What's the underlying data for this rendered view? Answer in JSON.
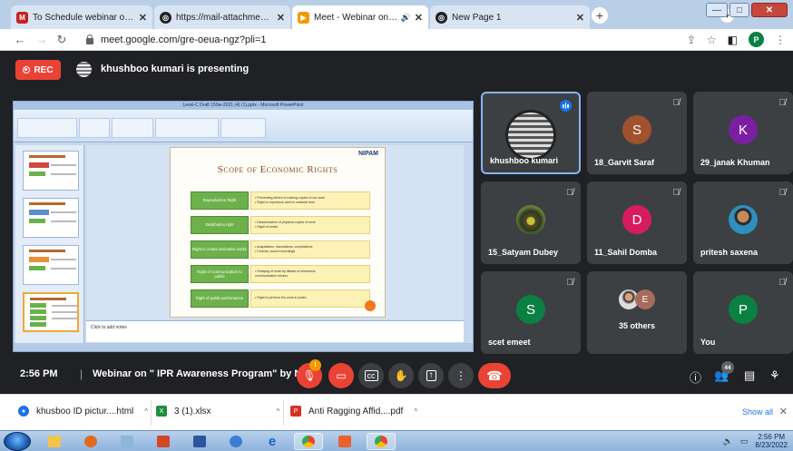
{
  "browser": {
    "tabs": [
      {
        "title": "To Schedule webinar on IPR Aw",
        "favicon_color": "#c5221f",
        "active": false
      },
      {
        "title": "https://mail-attachment.googleu",
        "favicon_color": "#202124",
        "active": false
      },
      {
        "title": "Meet - Webinar on \" IPR Aw",
        "favicon_color": "#f29900",
        "active": true
      },
      {
        "title": "New Page 1",
        "favicon_color": "#202124",
        "active": false
      }
    ],
    "url": "meet.google.com/gre-oeua-ngz?pli=1",
    "profile_initial": "P"
  },
  "meet": {
    "rec_label": "REC",
    "presenting_text": "khushboo kumari is presenting",
    "slide": {
      "window_title": "Level-C Draft 150w-2021 (4) (1).pptx - Microsoft PowerPoint",
      "logo": "NIPAM",
      "title": "Scope of Economic Rights",
      "notes_placeholder": "Click to add notes",
      "rows": [
        {
          "label": "Reproduction Right",
          "desc": [
            "• Preventing others of making copies of our work",
            "• Right to reproduce work in material form"
          ]
        },
        {
          "label": "Distribution right",
          "desc": [
            "• Dissemination of physical copies of work",
            "• Right of rental"
          ]
        },
        {
          "label": "Right to create derivative works",
          "desc": [
            "• Adaptations, translations, compilations",
            "• Cinema, sound recordings"
          ]
        },
        {
          "label": "Right of communication to public",
          "desc": [
            "• Relaying of work by distant or interactive",
            "  communication means"
          ]
        },
        {
          "label": "Right of public performance",
          "desc": [
            "• Right to perform the work in public"
          ]
        }
      ]
    },
    "participants": [
      {
        "name": "khushboo kumari",
        "initial": "",
        "color": "",
        "speaking": true
      },
      {
        "name": "18_Garvit Saraf",
        "initial": "S",
        "color": "#a0522d",
        "speaking": false
      },
      {
        "name": "29_janak Khuman",
        "initial": "K",
        "color": "#7b1fa2",
        "speaking": false
      },
      {
        "name": "15_Satyam Dubey",
        "initial": "",
        "color": "",
        "speaking": false
      },
      {
        "name": "11_Sahil Domba",
        "initial": "D",
        "color": "#d81b60",
        "speaking": false
      },
      {
        "name": "pritesh saxena",
        "initial": "",
        "color": "",
        "speaking": false
      },
      {
        "name": "scet emeet",
        "initial": "S",
        "color": "#0b8043",
        "speaking": false
      },
      {
        "name": "35 others",
        "initial": "E",
        "color": "#a66b5b",
        "speaking": false
      },
      {
        "name": "You",
        "initial": "P",
        "color": "#0b8043",
        "speaking": false
      }
    ],
    "bottom": {
      "time": "2:56 PM",
      "separator": "|",
      "meeting_title": "Webinar on \" IPR Awareness Program\" by N...",
      "mic_badge": "!",
      "people_count": "44"
    }
  },
  "downloads": {
    "items": [
      {
        "name": "khusboo ID pictur....html",
        "icon_color": "#1a73e8"
      },
      {
        "name": "3 (1).xlsx",
        "icon_color": "#1e8e3e"
      },
      {
        "name": "Anti Ragging Affid....pdf",
        "icon_color": "#d93025"
      }
    ],
    "show_all": "Show all"
  },
  "taskbar": {
    "time": "2:56 PM",
    "date": "8/23/2022"
  }
}
